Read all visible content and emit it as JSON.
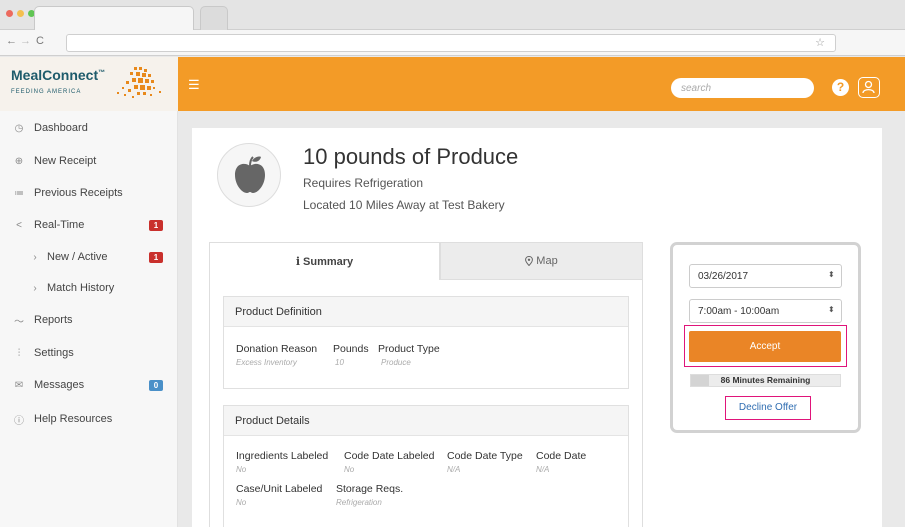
{
  "app": {
    "logo_main": "MealConnect",
    "logo_mark": "™",
    "logo_sub": "FEEDING AMERICA"
  },
  "header": {
    "search_placeholder": "search",
    "help_symbol": "?"
  },
  "sidebar": {
    "items": [
      {
        "label": "Dashboard",
        "icon": "dashboard-icon"
      },
      {
        "label": "New Receipt",
        "icon": "new-receipt-icon"
      },
      {
        "label": "Previous Receipts",
        "icon": "list-icon"
      },
      {
        "label": "Real-Time",
        "icon": "share-icon",
        "badge": "1"
      },
      {
        "label": "New / Active",
        "icon": "chevron-right-icon",
        "badge": "1"
      },
      {
        "label": "Match History",
        "icon": "chevron-right-icon"
      },
      {
        "label": "Reports",
        "icon": "chart-icon"
      },
      {
        "label": "Settings",
        "icon": "sliders-icon"
      },
      {
        "label": "Messages",
        "icon": "envelope-icon",
        "badge": "0"
      },
      {
        "label": "Help Resources",
        "icon": "help-circle-icon"
      }
    ]
  },
  "product": {
    "title": "10 pounds of Produce",
    "refrigeration": "Requires Refrigeration",
    "location": "Located 10 Miles Away at Test Bakery"
  },
  "tabs": {
    "summary": "Summary",
    "map": "Map"
  },
  "definition": {
    "header": "Product Definition",
    "fields": [
      {
        "label": "Donation Reason",
        "value": "Excess Inventory"
      },
      {
        "label": "Pounds",
        "value": "10"
      },
      {
        "label": "Product Type",
        "value": "Produce"
      }
    ]
  },
  "details": {
    "header": "Product Details",
    "fields": [
      {
        "label": "Ingredients Labeled",
        "value": "No"
      },
      {
        "label": "Code Date Labeled",
        "value": "No"
      },
      {
        "label": "Code Date Type",
        "value": "N/A"
      },
      {
        "label": "Code Date",
        "value": "N/A"
      },
      {
        "label": "Case/Unit Labeled",
        "value": "No"
      },
      {
        "label": "Storage Reqs.",
        "value": "Refrigeration"
      }
    ]
  },
  "actions": {
    "date_selected": "03/26/2017",
    "time_selected": "7:00am - 10:00am",
    "accept_label": "Accept",
    "remaining": "86 Minutes Remaining",
    "remaining_fraction": 0.12,
    "decline_label": "Decline Offer"
  },
  "colors": {
    "brand_orange": "#f39b27",
    "accept_orange": "#ea8526",
    "highlight_magenta": "#e0147a",
    "link_blue": "#2f6db1"
  }
}
